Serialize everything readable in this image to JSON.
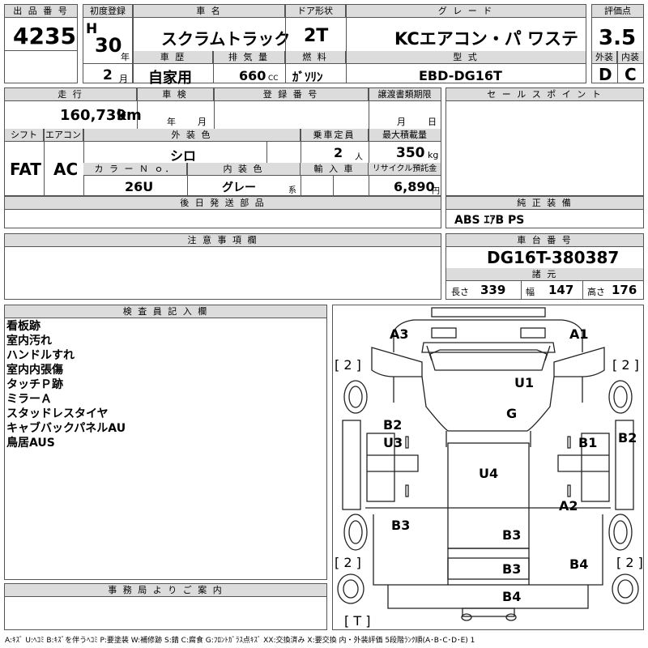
{
  "header": {
    "lot_label": "出 品 番 号",
    "lot_value": "4235",
    "reg_label": "初度登録",
    "era": "H",
    "year": "30",
    "year_unit": "年",
    "month": "2",
    "month_unit": "月",
    "name_label": "車 名",
    "name_value": "スクラムトラック",
    "door_label": "ドア形状",
    "door_value": "2T",
    "grade_label": "グ レ ー ド",
    "grade_value": "KCエアコン・パ ワステ",
    "score_label": "評価点",
    "score_value": "3.5",
    "history_label": "車 歴",
    "history_value": "自家用",
    "displacement_label": "排 気 量",
    "displacement_value": "660",
    "displacement_unit": "CC",
    "fuel_label": "燃 料",
    "fuel_value": "ｶﾞｿﾘﾝ",
    "model_label": "型 式",
    "model_value": "EBD-DG16T",
    "ext_label": "外装",
    "ext_value": "D",
    "int_label": "内装",
    "int_value": "C"
  },
  "row2": {
    "mileage_label": "走 行",
    "mileage_value": "160,739",
    "mileage_unit": "km",
    "inspection_label": "車 検",
    "insp_year_unit": "年",
    "insp_month_unit": "月",
    "regno_label": "登 録 番 号",
    "transfer_label": "譲渡書類期限",
    "transfer_month_unit": "月",
    "transfer_day_unit": "日",
    "sales_label": "セ ー ル ス ポ イ ン ト",
    "shift_label": "シフト",
    "shift_value": "FAT",
    "ac_label": "エアコン",
    "ac_value": "AC",
    "color_label": "外 装 色",
    "color_value": "シロ",
    "seats_label": "乗車定員",
    "seats_value": "2",
    "seats_unit": "人",
    "load_label": "最大積載量",
    "load_value": "350",
    "load_unit": "kg",
    "colorno_label": "カ ラ ー Ｎ ｏ．",
    "colorno_value": "26U",
    "intcolor_label": "内 装 色",
    "intcolor_value": "グレー",
    "intcolor_unit": "系",
    "import_label": "輸 入 車",
    "recycle_label": "リサイクル預託金",
    "recycle_value": "6,890",
    "recycle_unit": "円",
    "later_label": "後 日 発 送 部 品",
    "equip_label": "純 正 装 備",
    "equip_value": "ABS ｴｱB PS"
  },
  "notes": {
    "label": "注 意 事 項 欄"
  },
  "chassis": {
    "label": "車 台 番 号",
    "value": "DG16T-380387",
    "dims_label": "諸 元",
    "len_label": "長さ",
    "len_value": "339",
    "wid_label": "幅",
    "wid_value": "147",
    "hei_label": "高さ",
    "hei_value": "176"
  },
  "inspector": {
    "label": "検 査 員 記 入 欄",
    "lines": [
      "看板跡",
      "室内汚れ",
      "ハンドルすれ",
      "室内内張傷",
      "タッチＰ跡",
      "ミラーＡ",
      "スタッドレスタイヤ",
      "キャブバックパネルAU",
      "鳥居AUS"
    ]
  },
  "office": {
    "label": "事 務 局 よ り ご 案 内"
  },
  "diagram": {
    "marks": [
      "A3",
      "A1",
      "[ 2 ]",
      "[ 2 ]",
      "U1",
      "G",
      "B2",
      "U3",
      "B1",
      "B2",
      "U4",
      "A2",
      "B3",
      "B3",
      "[ 2 ]",
      "B3",
      "B4",
      "[ 2 ]",
      "B4",
      "[ T ]"
    ]
  },
  "footer": "A:ｷｽﾞ  U:ﾍｺﾐ  B:ｷｽﾞを伴うﾍｺﾐ  P:要塗装  W:補修跡  S:錆  C:腐食  G:ﾌﾛﾝﾄｶﾞﾗｽ点ｷｽﾞ  XX:交換済み  X:要交換   内・外装評価  5段階ﾗﾝｸ順(A･B･C･D･E) 1"
}
